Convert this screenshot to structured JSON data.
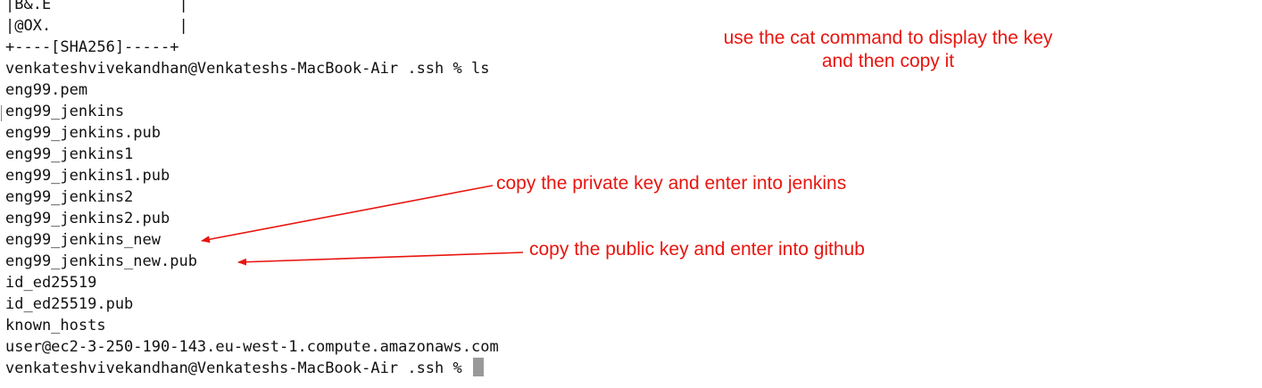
{
  "terminal": {
    "lines": [
      "|B&.E              |",
      "|@OX.              |",
      "+----[SHA256]-----+",
      "venkateshvivekandhan@Venkateshs-MacBook-Air .ssh % ls",
      "eng99.pem",
      "eng99_jenkins",
      "eng99_jenkins.pub",
      "eng99_jenkins1",
      "eng99_jenkins1.pub",
      "eng99_jenkins2",
      "eng99_jenkins2.pub",
      "eng99_jenkins_new",
      "eng99_jenkins_new.pub",
      "id_ed25519",
      "id_ed25519.pub",
      "known_hosts",
      "user@ec2-3-250-190-143.eu-west-1.compute.amazonaws.com"
    ],
    "prompt": "venkateshvivekandhan@Venkateshs-MacBook-Air .ssh % "
  },
  "annotations": {
    "cat_note_line1": "use the cat command to display the key",
    "cat_note_line2": "and then copy it",
    "private_key_note": "copy the private key and enter into jenkins",
    "public_key_note": "copy the public key and enter into github"
  },
  "colors": {
    "annotation": "#e8150f",
    "terminal_text": "#111111",
    "cursor": "#999999",
    "background": "#ffffff"
  }
}
